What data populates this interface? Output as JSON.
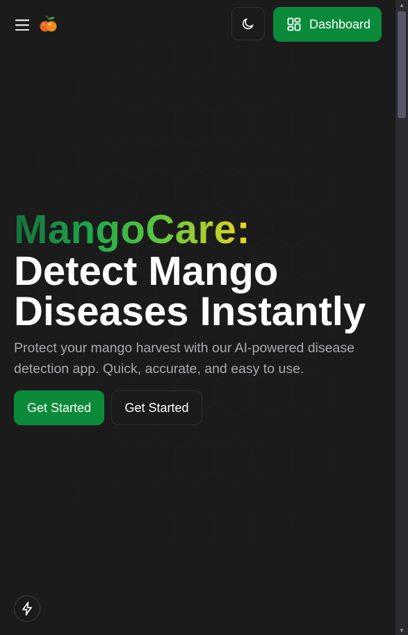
{
  "header": {
    "menu_icon": "hamburger-menu-icon",
    "logo_icon": "mango-fruit-icon",
    "theme_toggle_icon": "moon-icon",
    "dashboard_label": "Dashboard",
    "dashboard_icon": "dashboard-grid-icon"
  },
  "hero": {
    "brand": "MangoCare",
    "brand_suffix": ":",
    "headline": "Detect Mango Diseases Instantly",
    "description": "Protect your mango harvest with our AI-powered disease detection app. Quick, accurate, and easy to use.",
    "primary_cta": "Get Started",
    "secondary_cta": "Get Started"
  },
  "floating": {
    "icon": "lightning-bolt-icon"
  },
  "colors": {
    "background": "#1b1b1c",
    "accent_green": "#0b8a3a",
    "brand_gradient": [
      "#16703a",
      "#1fa84a",
      "#5cc640",
      "#d8d424"
    ],
    "text_primary": "#ffffff",
    "text_secondary": "#a8a8ad"
  }
}
